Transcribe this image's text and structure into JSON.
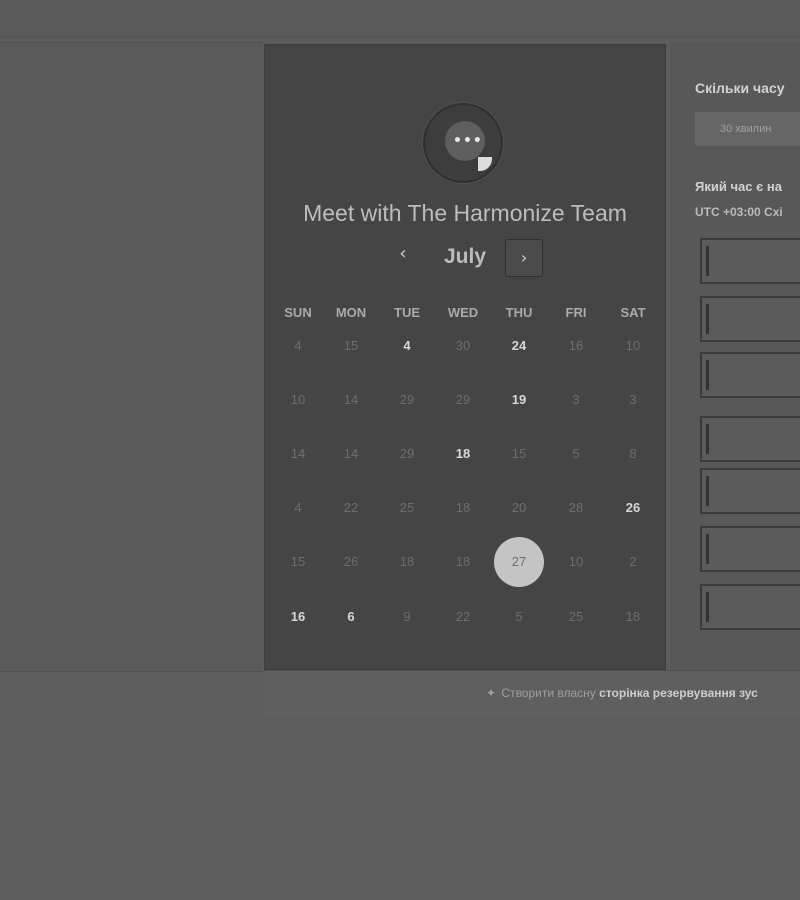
{
  "booking": {
    "title": "Meet with The Harmonize Team",
    "logo_text": "•••",
    "month": "July",
    "prev_icon": "‹",
    "next_icon": "›",
    "weekdays": [
      "SUN",
      "MON",
      "TUE",
      "WED",
      "THU",
      "FRI",
      "SAT"
    ],
    "weeks": [
      [
        {
          "d": "4"
        },
        {
          "d": "15"
        },
        {
          "d": "4",
          "a": true
        },
        {
          "d": "30"
        },
        {
          "d": "24",
          "a": true
        },
        {
          "d": "16"
        },
        {
          "d": "10"
        }
      ],
      [
        {
          "d": "10"
        },
        {
          "d": "14"
        },
        {
          "d": "29"
        },
        {
          "d": "29"
        },
        {
          "d": "19",
          "a": true
        },
        {
          "d": "3"
        },
        {
          "d": "3"
        }
      ],
      [
        {
          "d": "14"
        },
        {
          "d": "14"
        },
        {
          "d": "29"
        },
        {
          "d": "18",
          "a": true
        },
        {
          "d": "15"
        },
        {
          "d": "5"
        },
        {
          "d": "8"
        }
      ],
      [
        {
          "d": "4"
        },
        {
          "d": "22"
        },
        {
          "d": "25"
        },
        {
          "d": "18"
        },
        {
          "d": "20"
        },
        {
          "d": "28"
        },
        {
          "d": "26",
          "a": true
        }
      ],
      [
        {
          "d": "15"
        },
        {
          "d": "26"
        },
        {
          "d": "18"
        },
        {
          "d": "18"
        },
        {
          "d": "27",
          "s": true
        },
        {
          "d": "10"
        },
        {
          "d": "2"
        }
      ],
      [
        {
          "d": "16",
          "a": true
        },
        {
          "d": "6",
          "a": true
        },
        {
          "d": "9"
        },
        {
          "d": "22"
        },
        {
          "d": "5"
        },
        {
          "d": "25"
        },
        {
          "d": "18"
        }
      ]
    ]
  },
  "right_panel": {
    "duration_heading": "Скільки часу",
    "duration_option": "30 хвилин",
    "time_question": "Який час є на",
    "timezone": "UTC +03:00 Схі"
  },
  "footer": {
    "icon": "✦",
    "text": "Створити власну",
    "link": "сторінка резервування зус"
  },
  "colors": {
    "card_bg": "#454545",
    "page_bg": "#5d5d5d",
    "selected_day": "#c4c4c4"
  }
}
